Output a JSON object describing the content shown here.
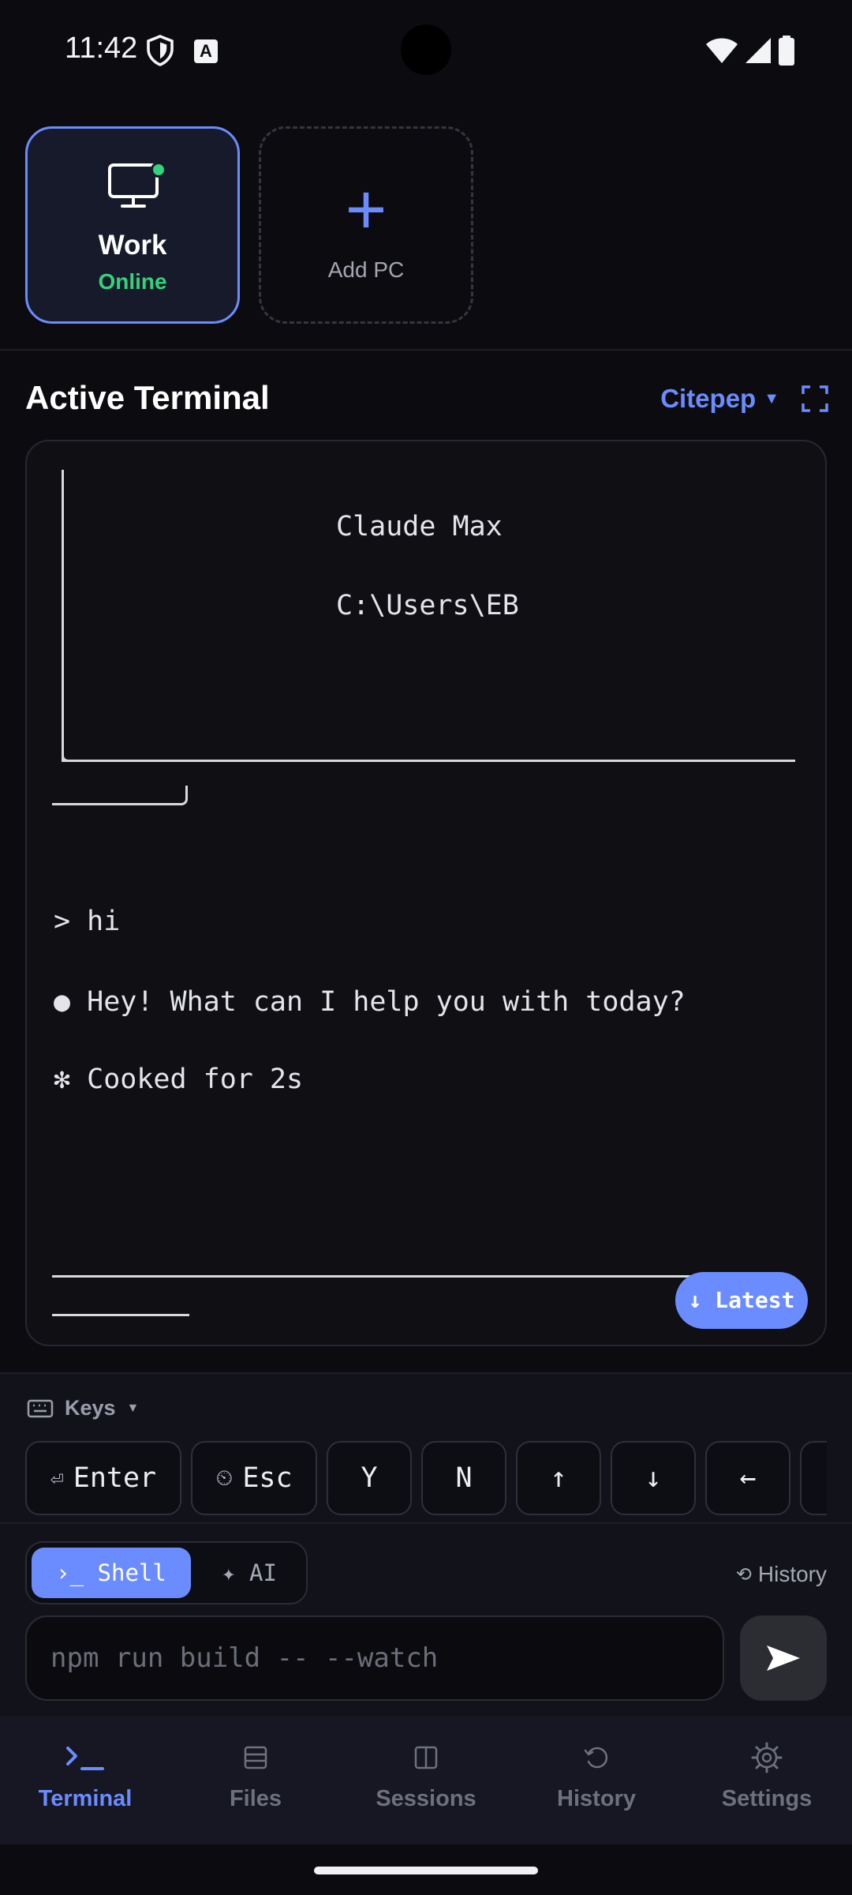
{
  "status_bar": {
    "time": "11:42",
    "a_icon_letter": "A"
  },
  "pcs": [
    {
      "name": "Work",
      "status": "Online",
      "icon": "monitor-icon",
      "active": true
    },
    {
      "name": "Add PC",
      "icon": "plus-icon"
    }
  ],
  "terminal_section": {
    "title": "Active Terminal",
    "session": "Citepep",
    "lines": {
      "claude_title": "Claude Max",
      "cwd": "C:\\Users\\EB",
      "prompt": "> hi",
      "reply": "● Hey! What can I help you with today?",
      "cooked": "✻ Cooked for 2s"
    },
    "latest_button": "↓ Latest"
  },
  "keys": {
    "label": "Keys",
    "items": [
      {
        "icon": "⏎",
        "label": "Enter"
      },
      {
        "icon": "⏲",
        "label": "Esc"
      },
      {
        "label": "Y"
      },
      {
        "label": "N"
      },
      {
        "label": "↑"
      },
      {
        "label": "↓"
      },
      {
        "label": "←"
      }
    ]
  },
  "input": {
    "mode_shell": "›_ Shell",
    "mode_ai": "✦ AI",
    "history": "History",
    "placeholder": "npm run build -- --watch"
  },
  "nav": [
    {
      "label": "Terminal",
      "icon": "terminal-icon",
      "active": true
    },
    {
      "label": "Files",
      "icon": "files-icon"
    },
    {
      "label": "Sessions",
      "icon": "sessions-icon"
    },
    {
      "label": "History",
      "icon": "history-icon"
    },
    {
      "label": "Settings",
      "icon": "settings-icon"
    }
  ],
  "colors": {
    "accent": "#6b8cff",
    "online": "#34d27b",
    "background": "#0c0c10"
  }
}
